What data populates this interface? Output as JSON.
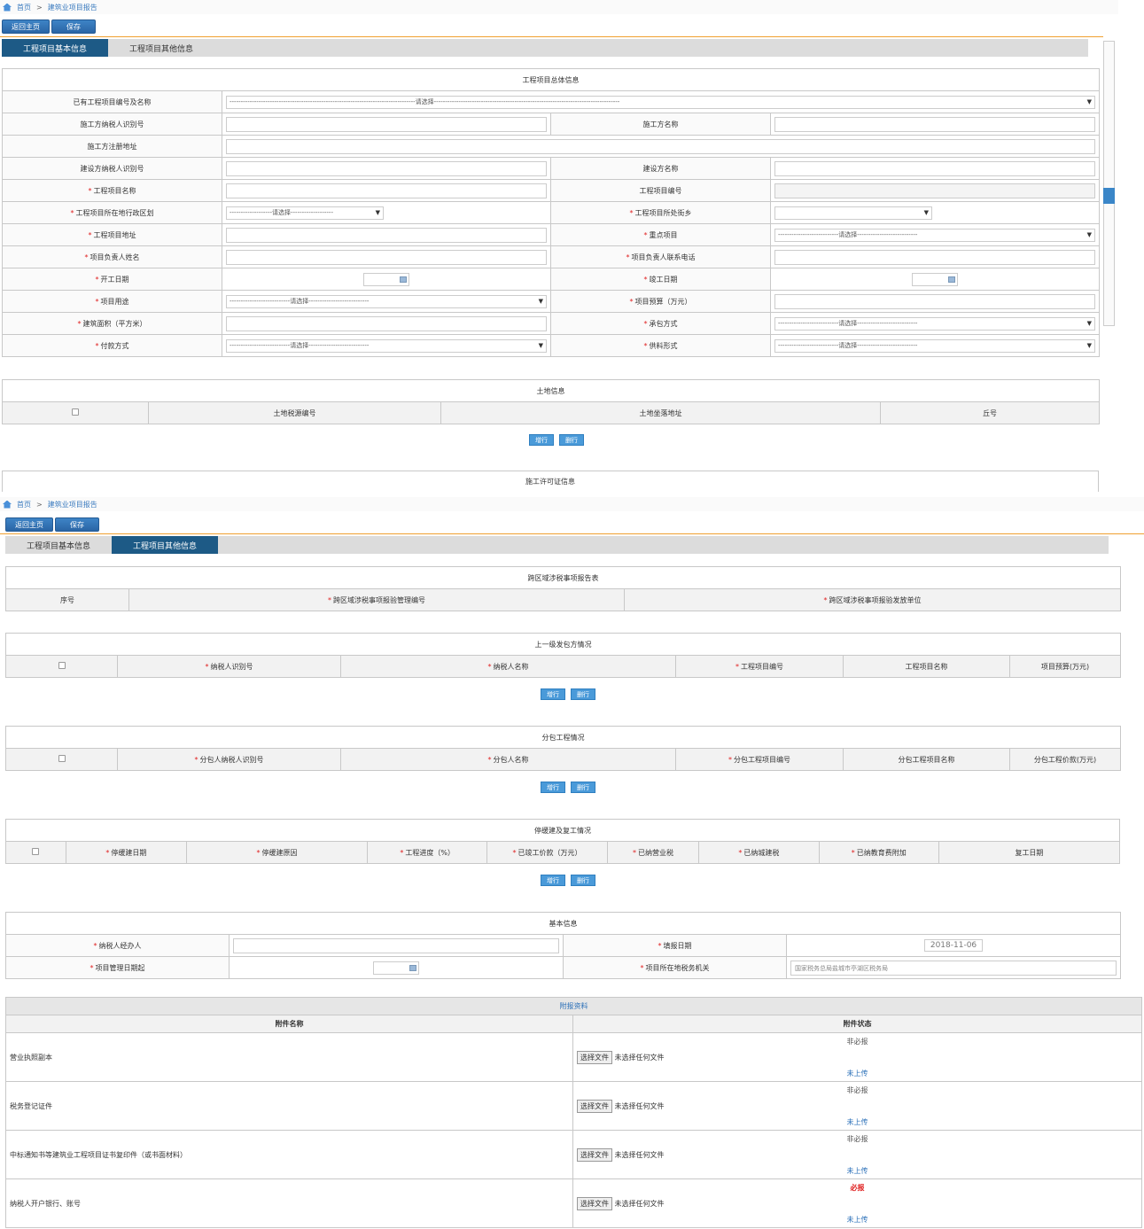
{
  "breadcrumb": {
    "home": "首页",
    "sep": ">",
    "current": "建筑业项目报告"
  },
  "toolbar": {
    "back_label": "返回主页",
    "save_label": "保存"
  },
  "tabs": [
    "工程项目基本信息",
    "工程项目其他信息"
  ],
  "section1": {
    "title": "工程项目总体信息",
    "rows": [
      {
        "l1": "已有工程项目编号及名称",
        "sel1": "-----------------------------------------------------------------------------------请选择-----------------------------------------------------------------------------------"
      },
      {
        "l1": "施工方纳税人识别号",
        "l2": "施工方名称"
      },
      {
        "l1": "施工方注册地址"
      },
      {
        "l1": "建设方纳税人识别号",
        "l2": "建设方名称"
      },
      {
        "l1": "工程项目名称",
        "l2": "工程项目编号"
      },
      {
        "l1": "工程项目所在地行政区划",
        "sel1": "-------------------请选择-------------------",
        "l2": "工程项目所处街乡"
      },
      {
        "l1": "工程项目地址",
        "l2": "重点项目",
        "sel2": "---------------------------请选择---------------------------"
      },
      {
        "l1": "项目负责人姓名",
        "l2": "项目负责人联系电话"
      },
      {
        "l1": "开工日期",
        "l2": "竣工日期"
      },
      {
        "l1": "项目用途",
        "sel1": "---------------------------请选择---------------------------",
        "l2": "项目预算（万元）"
      },
      {
        "l1": "建筑面积（平方米）",
        "l2": "承包方式",
        "sel2": "---------------------------请选择---------------------------"
      },
      {
        "l1": "付款方式",
        "sel1": "---------------------------请选择---------------------------",
        "l2": "供料形式",
        "sel2": "---------------------------请选择---------------------------"
      }
    ]
  },
  "land": {
    "title": "土地信息",
    "cols": [
      "土地税源编号",
      "土地坐落地址",
      "丘号"
    ]
  },
  "add_row": "增行",
  "del_row": "删行",
  "permit": {
    "title": "施工许可证信息"
  },
  "cross": {
    "title": "跨区域涉税事项报告表",
    "cols": [
      "序号",
      "跨区域涉税事项报验管理编号",
      "跨区域涉税事项报验发放单位"
    ]
  },
  "upper": {
    "title": "上一级发包方情况",
    "cols": [
      "纳税人识别号",
      "纳税人名称",
      "工程项目编号",
      "工程项目名称",
      "项目预算(万元)"
    ]
  },
  "sub": {
    "title": "分包工程情况",
    "cols": [
      "分包人纳税人识别号",
      "分包人名称",
      "分包工程项目编号",
      "分包工程项目名称",
      "分包工程价款(万元)"
    ]
  },
  "suspend": {
    "title": "停缓建及复工情况",
    "cols": [
      "停缓建日期",
      "停缓建原因",
      "工程进度（%）",
      "已竣工价款（万元）",
      "已纳营业税",
      "已纳城建税",
      "已纳教育费附加",
      "复工日期"
    ]
  },
  "basic": {
    "title": "基本信息",
    "agent": "纳税人经办人",
    "fill_date": "填报日期",
    "fill_date_value": "2018-11-06",
    "deadline": "项目管理日期起",
    "tax_office": "项目所在地税务机关",
    "tax_office_value": "国家税务总局盐城市亭湖区税务局"
  },
  "attach": {
    "title": "附报资料",
    "col_name": "附件名称",
    "col_status": "附件状态",
    "choose": "选择文件",
    "nofile": "未选择任何文件",
    "uploaded": "未上传",
    "items": [
      {
        "name": "营业执照副本",
        "status": "非必报"
      },
      {
        "name": "税务登记证件",
        "status": "非必报"
      },
      {
        "name": "中标通知书等建筑业工程项目证书复印件（或书面材料）",
        "status": "非必报"
      },
      {
        "name": "纳税人开户银行、账号",
        "status": "必报"
      }
    ]
  }
}
